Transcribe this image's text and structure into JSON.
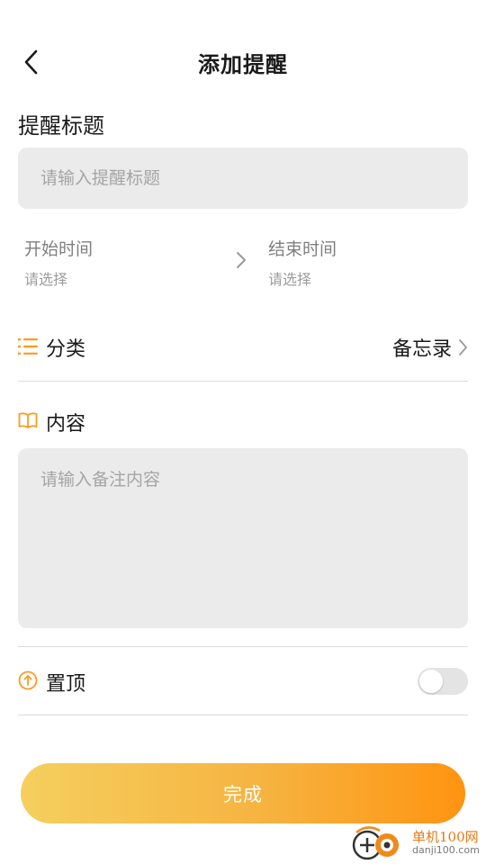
{
  "header": {
    "title": "添加提醒",
    "back_icon": "chevron-left-icon"
  },
  "reminder_title": {
    "label": "提醒标题",
    "placeholder": "请输入提醒标题",
    "value": ""
  },
  "start_time": {
    "label": "开始时间",
    "value": "请选择"
  },
  "end_time": {
    "label": "结束时间",
    "value": "请选择"
  },
  "category": {
    "label": "分类",
    "value": "备忘录",
    "icon": "list-icon"
  },
  "content": {
    "label": "内容",
    "placeholder": "请输入备注内容",
    "icon": "book-icon"
  },
  "pin_top": {
    "label": "置顶",
    "enabled": false,
    "icon": "pin-up-icon"
  },
  "done_button": {
    "label": "完成"
  },
  "watermark": {
    "line1": "单机100网",
    "line2": "danji100.com"
  },
  "colors": {
    "accent": "#ff9a1f",
    "field_bg": "#ebebeb",
    "button_start": "#f5cf5e",
    "button_end": "#ff9410"
  }
}
